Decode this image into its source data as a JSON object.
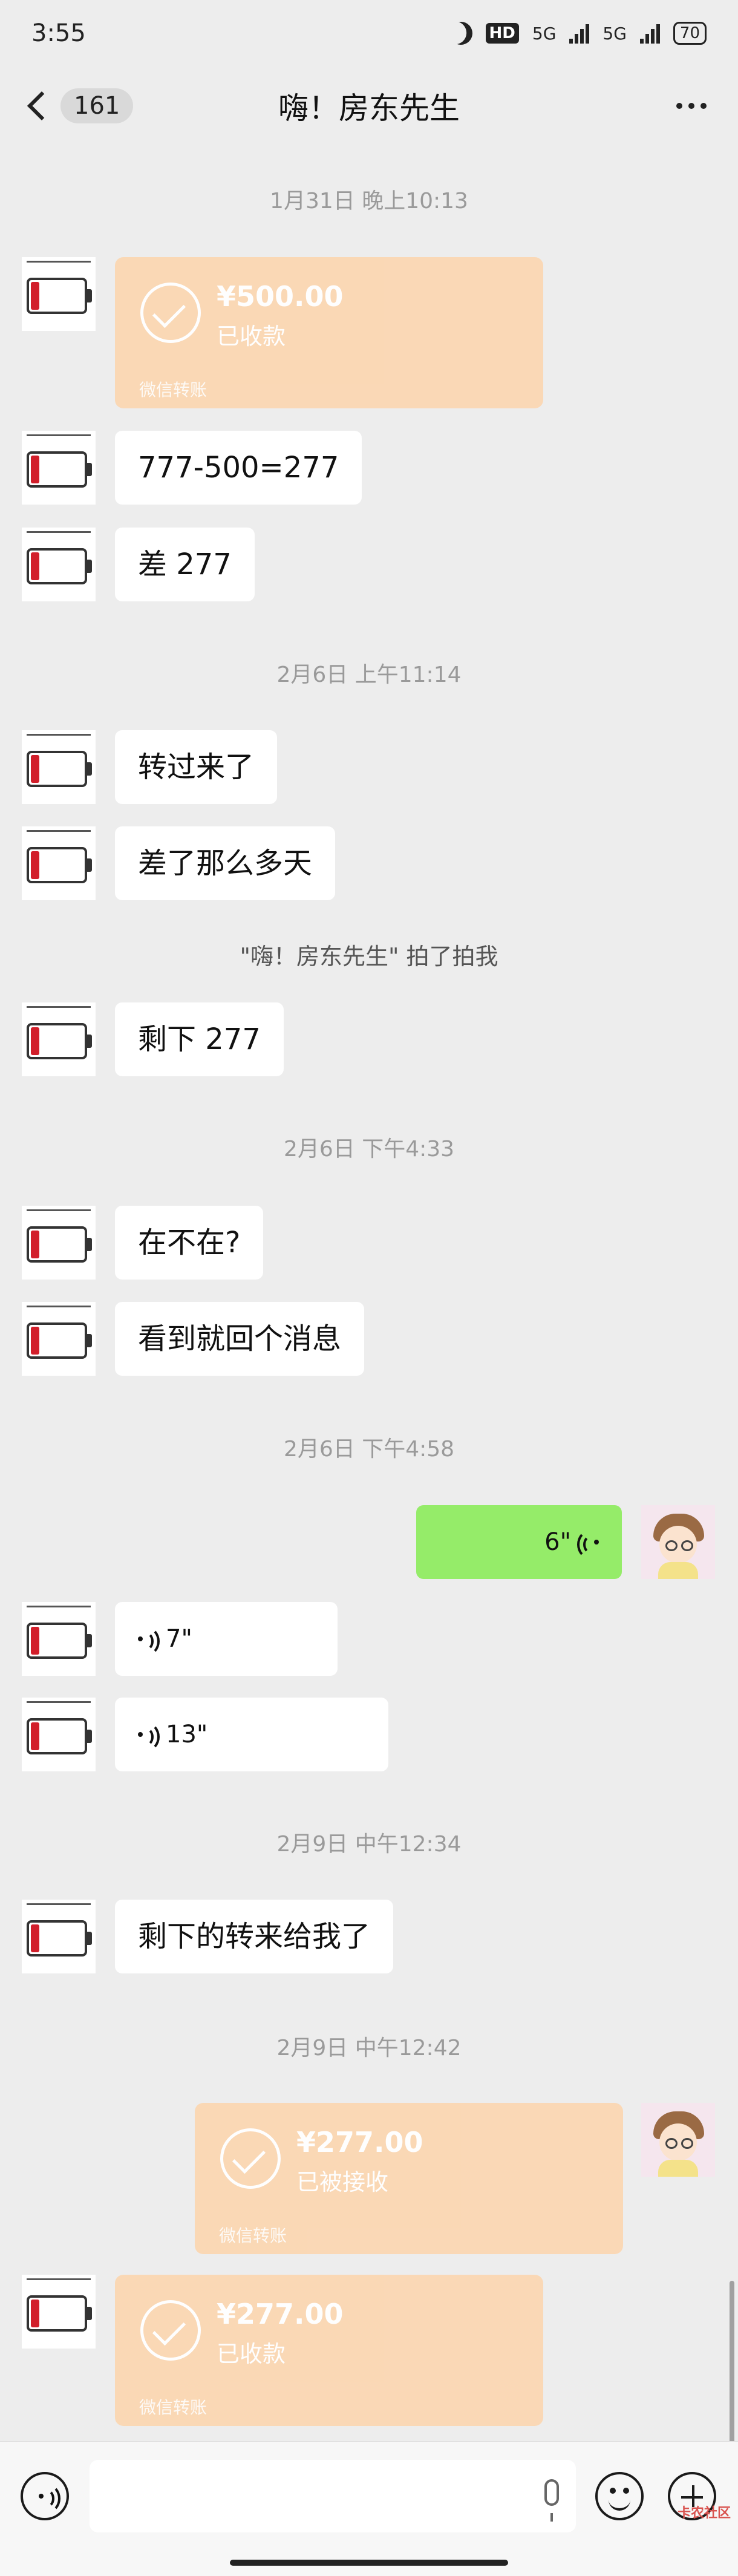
{
  "status_bar": {
    "time": "3:55",
    "hd_label": "HD",
    "network_1": "5G",
    "network_2": "5G",
    "battery": "70"
  },
  "nav": {
    "unread_count": "161",
    "title": "嗨！房东先生"
  },
  "timestamps": [
    "1月31日 晚上10:13",
    "2月6日 上午11:14",
    "2月6日 下午4:33",
    "2月6日 下午4:58",
    "2月9日 中午12:34",
    "2月9日 中午12:42"
  ],
  "system_note": "\"嗨！房东先生\" 拍了拍我",
  "messages": {
    "transfer_received_1": {
      "amount": "¥500.00",
      "status": "已收款",
      "brand": "微信转账"
    },
    "text_1": "777-500=277",
    "text_2": "差 277",
    "text_3": "转过来了",
    "text_4": "差了那么多天",
    "text_5": "剩下 277",
    "text_6": "在不在?",
    "text_7": "看到就回个消息",
    "voice_me": "6\"",
    "voice_1": "7\"",
    "voice_2": "13\"",
    "text_8": "剩下的转来给我了",
    "transfer_sent": {
      "amount": "¥277.00",
      "status": "已被接收",
      "brand": "微信转账"
    },
    "transfer_received_2": {
      "amount": "¥277.00",
      "status": "已收款",
      "brand": "微信转账"
    }
  },
  "bottom": {
    "watermark": "卡农社区"
  }
}
